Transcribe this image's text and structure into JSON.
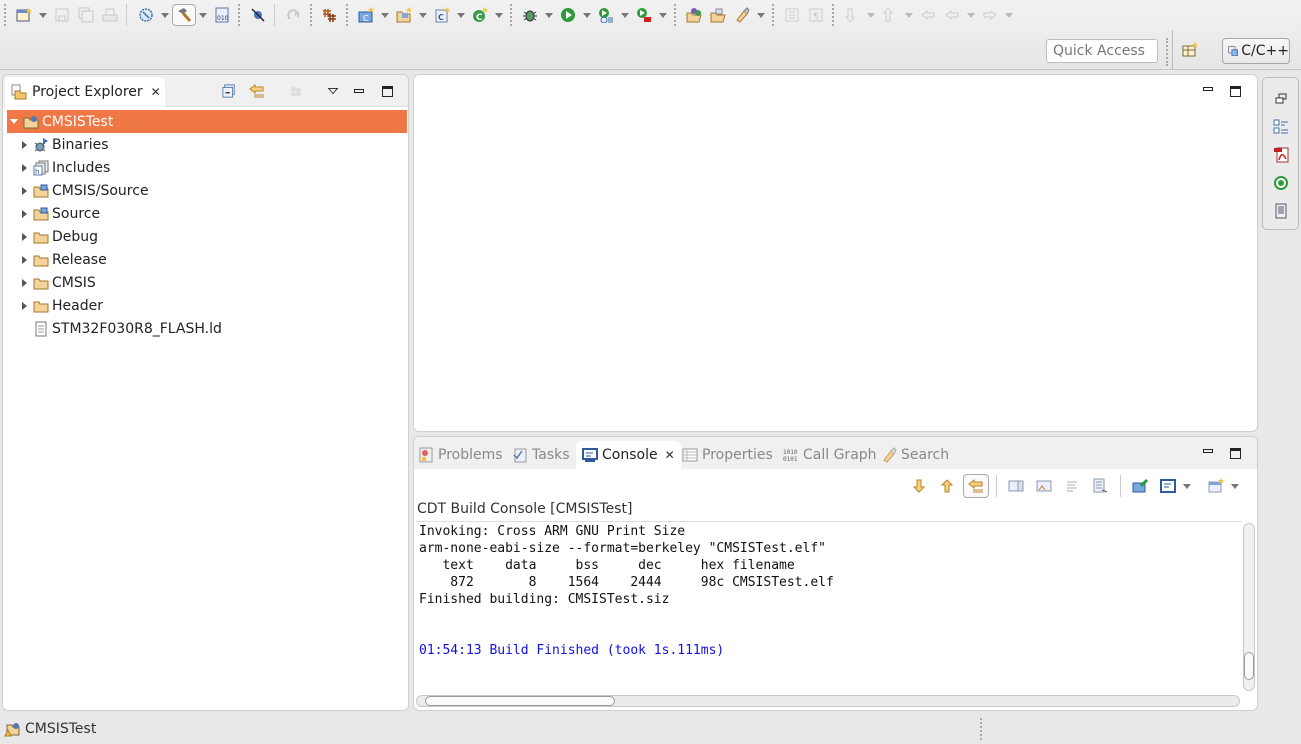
{
  "toolbar": {
    "icons": [
      "new-icon",
      "save-icon",
      "save-all-icon",
      "print-icon",
      "manage-configs-icon",
      "build-icon",
      "build-binary-icon",
      "skip-breakpoints-icon",
      "resume-icon",
      "build-all-icon",
      "new-cpp-project-icon",
      "new-source-folder-icon",
      "new-source-file-icon",
      "new-class-icon",
      "debug-icon",
      "run-icon",
      "run-profile-icon",
      "external-tools-icon",
      "open-type-icon",
      "open-element-icon",
      "search-icon",
      "toggle-mark-icon",
      "show-whitespace-icon",
      "next-annotation-icon",
      "prev-annotation-icon",
      "last-edit-icon",
      "back-icon",
      "forward-icon"
    ],
    "quick_access_placeholder": "Quick Access",
    "perspective_label": "C/C++"
  },
  "project_explorer": {
    "title": "Project Explorer",
    "tree": [
      {
        "label": "CMSISTest",
        "icon": "project-icon",
        "expanded": true,
        "selected": true,
        "level": 0
      },
      {
        "label": "Binaries",
        "icon": "binaries-icon",
        "expanded": false,
        "level": 1
      },
      {
        "label": "Includes",
        "icon": "includes-icon",
        "expanded": false,
        "level": 1
      },
      {
        "label": "CMSIS/Source",
        "icon": "source-folder-icon",
        "expanded": false,
        "level": 1
      },
      {
        "label": "Source",
        "icon": "source-folder-icon",
        "expanded": false,
        "level": 1
      },
      {
        "label": "Debug",
        "icon": "folder-icon",
        "expanded": false,
        "level": 1
      },
      {
        "label": "Release",
        "icon": "folder-icon",
        "expanded": false,
        "level": 1
      },
      {
        "label": "CMSIS",
        "icon": "folder-icon",
        "expanded": false,
        "level": 1
      },
      {
        "label": "Header",
        "icon": "folder-icon",
        "expanded": false,
        "level": 1
      },
      {
        "label": "STM32F030R8_FLASH.ld",
        "icon": "file-icon",
        "level": 1
      }
    ]
  },
  "bottom_panel": {
    "tabs": [
      {
        "label": "Problems",
        "icon": "problems-icon",
        "active": false
      },
      {
        "label": "Tasks",
        "icon": "tasks-icon",
        "active": false
      },
      {
        "label": "Console",
        "icon": "console-icon",
        "active": true
      },
      {
        "label": "Properties",
        "icon": "properties-icon",
        "active": false
      },
      {
        "label": "Call Graph",
        "icon": "call-graph-icon",
        "active": false
      },
      {
        "label": "Search",
        "icon": "search-icon",
        "active": false
      }
    ],
    "console_title": "CDT Build Console [CMSISTest]",
    "console_lines": [
      "Invoking: Cross ARM GNU Print Size",
      "arm-none-eabi-size --format=berkeley \"CMSISTest.elf\"",
      "   text\t   data\t    bss\t    dec\t    hex\tfilename",
      "    872\t      8\t   1564\t   2444\t    98c\tCMSISTest.elf",
      "Finished building: CMSISTest.siz",
      "",
      "",
      "01:54:13 Build Finished (took 1s.111ms)"
    ],
    "console_display": [
      "Invoking: Cross ARM GNU Print Size",
      "arm-none-eabi-size --format=berkeley \"CMSISTest.elf\"",
      "   text    data     bss     dec     hex filename",
      "    872       8    1564    2444     98c CMSISTest.elf",
      "Finished building: CMSISTest.siz",
      "",
      ""
    ],
    "console_final": "01:54:13 Build Finished (took 1s.111ms)"
  },
  "status_bar": {
    "text": "CMSISTest"
  }
}
